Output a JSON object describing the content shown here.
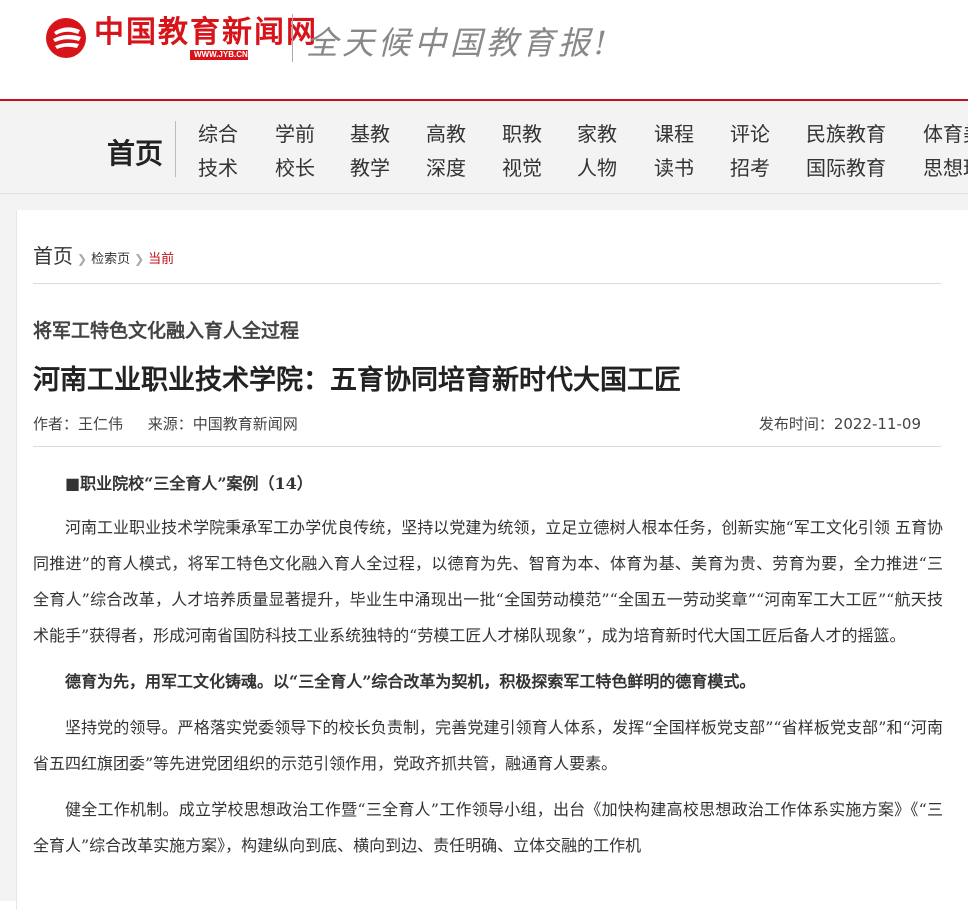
{
  "header": {
    "logo_text": "中国教育新闻网",
    "logo_url": "WWW.JYB.CN",
    "slogan": "全天候中国教育报!",
    "colors": {
      "brand_red": "#c3121b"
    }
  },
  "nav": {
    "home": "首页",
    "row1": [
      "综合",
      "学前",
      "基教",
      "高教",
      "职教",
      "家教",
      "课程",
      "评论",
      "民族教育",
      "体育美"
    ],
    "row2": [
      "技术",
      "校长",
      "教学",
      "深度",
      "视觉",
      "人物",
      "读书",
      "招考",
      "国际教育",
      "思想理"
    ]
  },
  "breadcrumb": {
    "home": "首页",
    "search": "检索页",
    "current": "当前"
  },
  "article": {
    "subtitle": "将军工特色文化融入育人全过程",
    "title": "河南工业职业技术学院：五育协同培育新时代大国工匠",
    "author": "作者：王仁伟",
    "source": "来源：中国教育新闻网",
    "published": "发布时间：2022-11-09",
    "series": "■职业院校“三全育人”案例（14）",
    "paragraphs": [
      "河南工业职业技术学院秉承军工办学优良传统，坚持以党建为统领，立足立德树人根本任务，创新实施“军工文化引领 五育协同推进”的育人模式，将军工特色文化融入育人全过程，以德育为先、智育为本、体育为基、美育为贵、劳育为要，全力推进“三全育人”综合改革，人才培养质量显著提升，毕业生中涌现出一批“全国劳动模范”“全国五一劳动奖章”“河南军工大工匠”“航天技术能手”获得者，形成河南省国防科技工业系统独特的“劳模工匠人才梯队现象”，成为培育新时代大国工匠后备人才的摇篮。",
      "德育为先，用军工文化铸魂。以“三全育人”综合改革为契机，积极探索军工特色鲜明的德育模式。",
      "坚持党的领导。严格落实党委领导下的校长负责制，完善党建引领育人体系，发挥“全国样板党支部”“省样板党支部”和“河南省五四红旗团委”等先进党团组织的示范引领作用，党政齐抓共管，融通育人要素。",
      "健全工作机制。成立学校思想政治工作暨“三全育人”工作领导小组，出台《加快构建高校思想政治工作体系实施方案》《“三全育人”综合改革实施方案》，构建纵向到底、横向到边、责任明确、立体交融的工作机"
    ]
  }
}
